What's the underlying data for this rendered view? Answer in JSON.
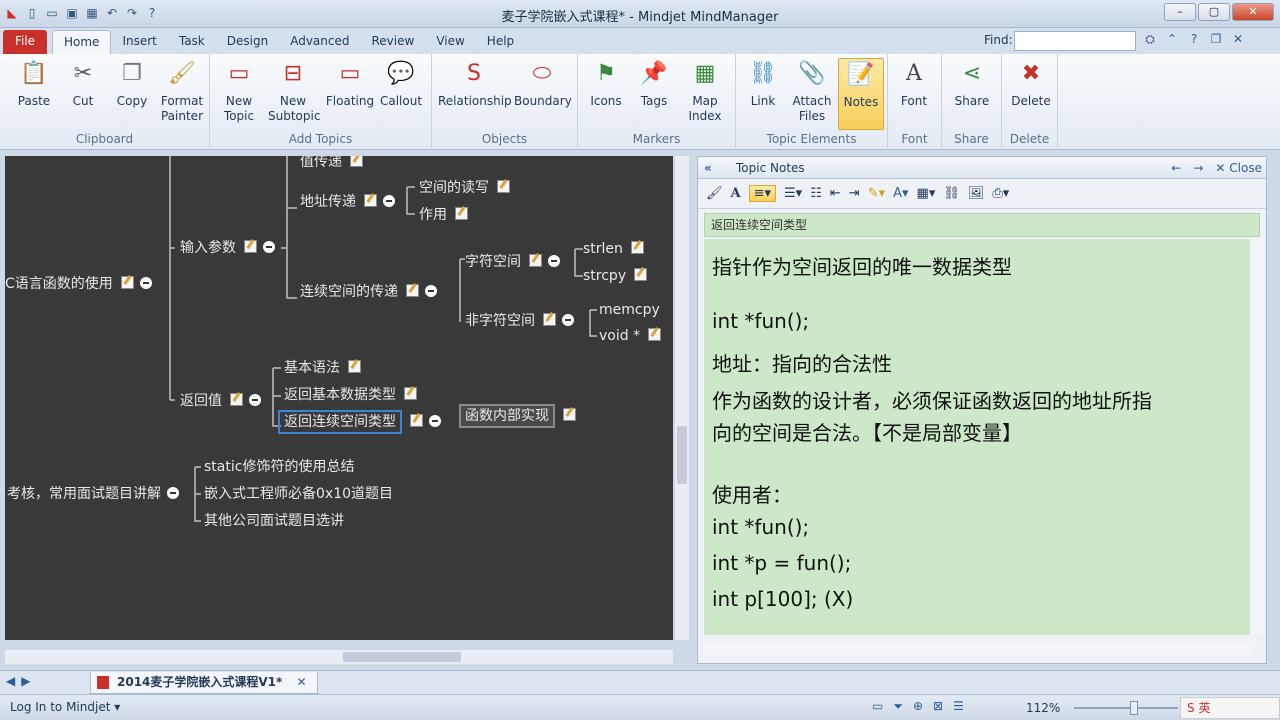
{
  "window": {
    "title": "麦子学院嵌入式课程* - Mindjet MindManager",
    "quick_icons": [
      "app-logo-icon",
      "new-icon",
      "open-icon",
      "save-icon",
      "save-all-icon",
      "undo-icon",
      "redo-icon",
      "help-icon"
    ]
  },
  "ribbon_tabs": {
    "file": "File",
    "items": [
      "Home",
      "Insert",
      "Task",
      "Design",
      "Advanced",
      "Review",
      "View",
      "Help"
    ],
    "active": "Home"
  },
  "find": {
    "label": "Find:",
    "value": ""
  },
  "ribbon": {
    "clipboard": {
      "label": "Clipboard",
      "paste": "Paste",
      "cut": "Cut",
      "copy": "Copy",
      "format_painter": "Format Painter"
    },
    "add_topics": {
      "label": "Add Topics",
      "new_topic": "New Topic",
      "new_subtopic": "New Subtopic",
      "floating": "Floating",
      "callout": "Callout"
    },
    "objects": {
      "label": "Objects",
      "relationship": "Relationship",
      "boundary": "Boundary"
    },
    "markers": {
      "label": "Markers",
      "icons": "Icons",
      "tags": "Tags",
      "map_index": "Map Index"
    },
    "topic_elements": {
      "label": "Topic Elements",
      "link": "Link",
      "attach_files": "Attach Files",
      "notes": "Notes"
    },
    "font": {
      "label": "Font",
      "font": "Font"
    },
    "share": {
      "label": "Share",
      "share": "Share"
    },
    "delete": {
      "label": "Delete",
      "delete": "Delete"
    }
  },
  "map": {
    "root1": "C语言函数的使用",
    "input_params": "输入参数",
    "value_pass": "值传递",
    "addr_pass": "地址传递",
    "space_rw": "空间的读写",
    "use": "作用",
    "contig_pass": "连续空间的传递",
    "char_space": "字符空间",
    "strlen": "strlen",
    "strcpy": "strcpy",
    "nonchar_space": "非字符空间",
    "memcpy": "memcpy",
    "void_ptr": "void *",
    "return_val": "返回值",
    "basic_syntax": "基本语法",
    "ret_basic": "返回基本数据类型",
    "ret_contig": "返回连续空间类型",
    "func_impl": "函数内部实现",
    "root2": "考核，常用面试题目讲解",
    "static_summary": "static修饰符的使用总结",
    "embedded_0x10": "嵌入式工程师必备0x10道题目",
    "other_companies": "其他公司面试题目选讲"
  },
  "notes": {
    "title": "Topic Notes",
    "close": "Close",
    "topic": "返回连续空间类型",
    "lines": [
      "指针作为空间返回的唯一数据类型",
      "int *fun();",
      "地址：指向的合法性",
      "作为函数的设计者，必须保证函数返回的地址所指",
      "向的空间是合法。【不是局部变量】",
      "使用者：",
      "int *fun();",
      "int *p = fun();",
      "int p[100];     (X)"
    ]
  },
  "doc_tab": "2014麦子学院嵌入式课程V1*",
  "status": {
    "login": "Log In to Mindjet",
    "zoom": "112%",
    "ime": "英"
  }
}
